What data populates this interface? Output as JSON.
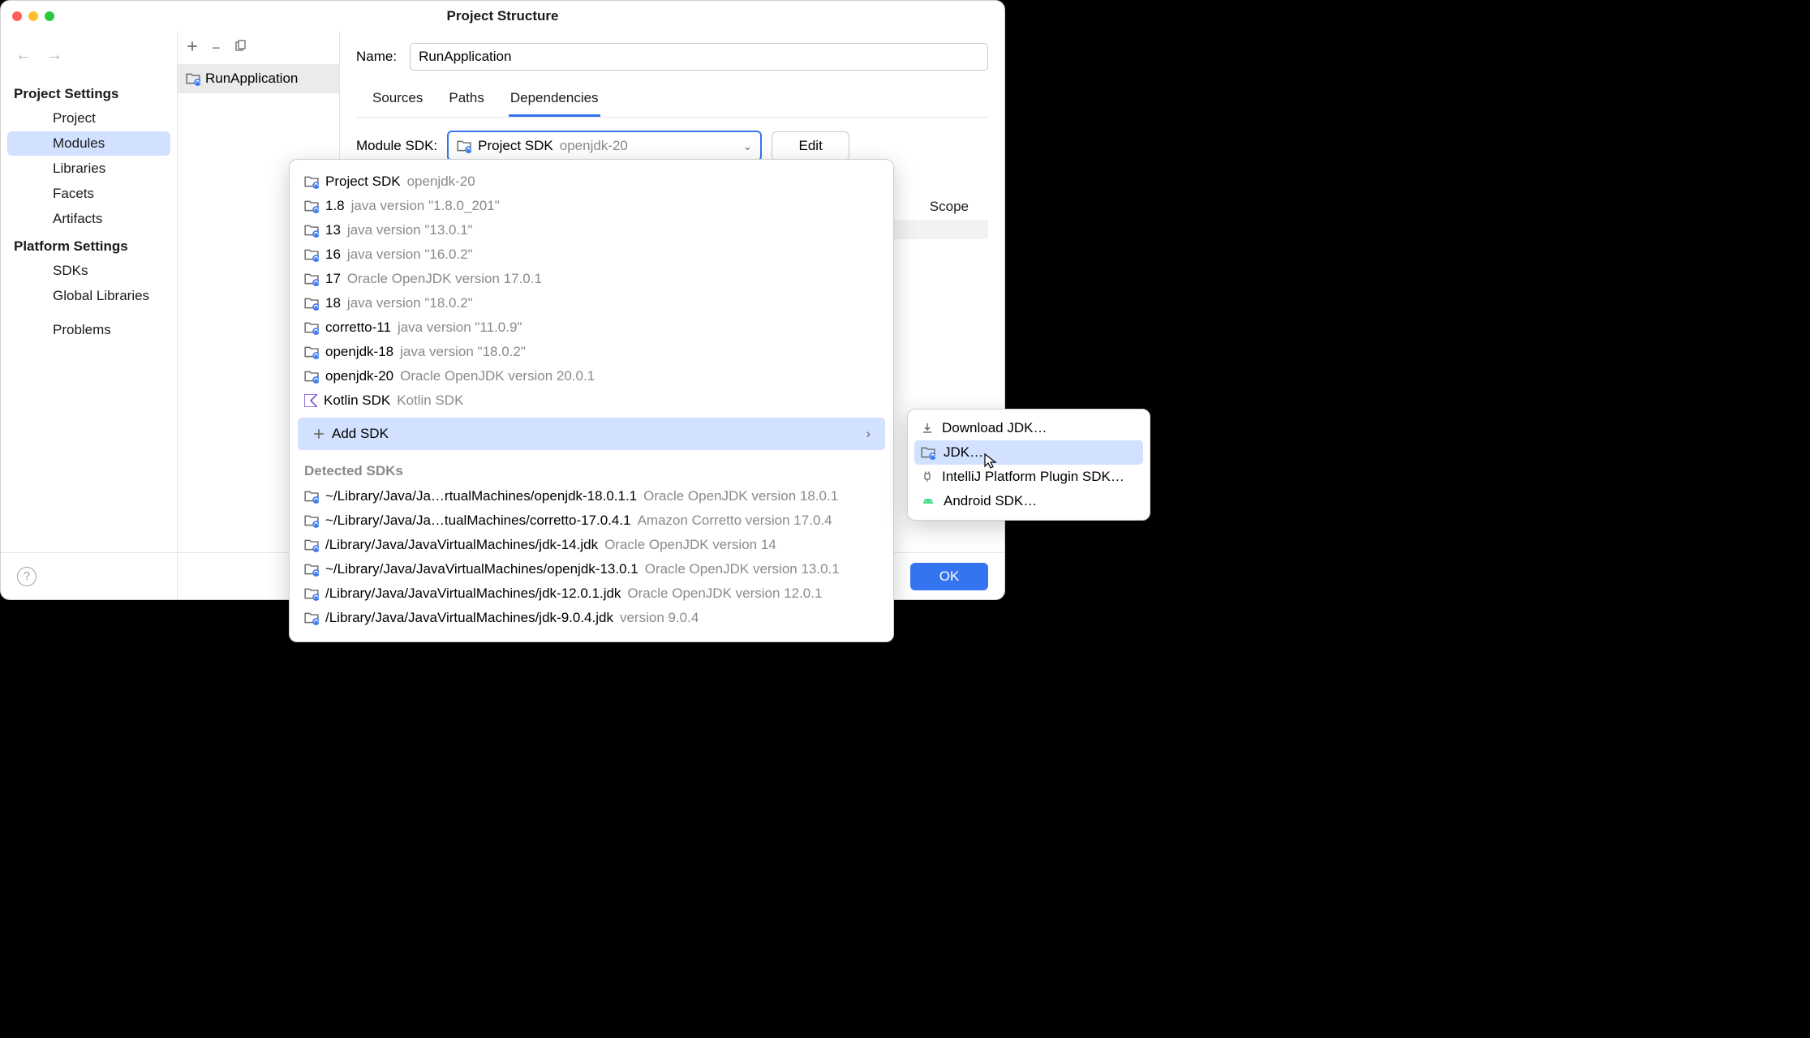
{
  "title": "Project Structure",
  "sidebar": {
    "project_settings_label": "Project Settings",
    "platform_settings_label": "Platform Settings",
    "items_ps": [
      "Project",
      "Modules",
      "Libraries",
      "Facets",
      "Artifacts"
    ],
    "items_plat": [
      "SDKs",
      "Global Libraries"
    ],
    "problems": "Problems"
  },
  "module_list": {
    "items": [
      "RunApplication"
    ]
  },
  "form": {
    "name_label": "Name:",
    "name_value": "RunApplication",
    "tabs": [
      "Sources",
      "Paths",
      "Dependencies"
    ],
    "sdk_label": "Module SDK:",
    "sdk_selected_main": "Project SDK",
    "sdk_selected_sub": "openjdk-20",
    "edit_label": "Edit",
    "scope_label": "Scope"
  },
  "dropdown": {
    "items": [
      {
        "name": "Project SDK",
        "detail": "openjdk-20",
        "icon": "jdk"
      },
      {
        "name": "1.8",
        "detail": "java version \"1.8.0_201\"",
        "icon": "jdk"
      },
      {
        "name": "13",
        "detail": "java version \"13.0.1\"",
        "icon": "jdk"
      },
      {
        "name": "16",
        "detail": "java version \"16.0.2\"",
        "icon": "jdk"
      },
      {
        "name": "17",
        "detail": "Oracle OpenJDK version 17.0.1",
        "icon": "jdk"
      },
      {
        "name": "18",
        "detail": "java version \"18.0.2\"",
        "icon": "jdk"
      },
      {
        "name": "corretto-11",
        "detail": "java version \"11.0.9\"",
        "icon": "jdk"
      },
      {
        "name": "openjdk-18",
        "detail": "java version \"18.0.2\"",
        "icon": "jdk"
      },
      {
        "name": "openjdk-20",
        "detail": "Oracle OpenJDK version 20.0.1",
        "icon": "jdk"
      },
      {
        "name": "Kotlin SDK",
        "detail": "Kotlin SDK",
        "icon": "kotlin"
      }
    ],
    "add_label": "Add SDK",
    "detected_label": "Detected SDKs",
    "detected": [
      {
        "path": "~/Library/Java/Ja…rtualMachines/openjdk-18.0.1.1",
        "detail": "Oracle OpenJDK version 18.0.1"
      },
      {
        "path": "~/Library/Java/Ja…tualMachines/corretto-17.0.4.1",
        "detail": "Amazon Corretto version 17.0.4"
      },
      {
        "path": "/Library/Java/JavaVirtualMachines/jdk-14.jdk",
        "detail": "Oracle OpenJDK version 14"
      },
      {
        "path": "~/Library/Java/JavaVirtualMachines/openjdk-13.0.1",
        "detail": "Oracle OpenJDK version 13.0.1"
      },
      {
        "path": "/Library/Java/JavaVirtualMachines/jdk-12.0.1.jdk",
        "detail": "Oracle OpenJDK version 12.0.1"
      },
      {
        "path": "/Library/Java/JavaVirtualMachines/jdk-9.0.4.jdk",
        "detail": "version 9.0.4"
      }
    ]
  },
  "submenu": {
    "items": [
      {
        "label": "Download JDK…",
        "icon": "download"
      },
      {
        "label": "JDK…",
        "icon": "jdk",
        "selected": true
      },
      {
        "label": "IntelliJ Platform Plugin SDK…",
        "icon": "plugin"
      },
      {
        "label": "Android SDK…",
        "icon": "android"
      }
    ]
  },
  "footer": {
    "ok": "OK"
  }
}
